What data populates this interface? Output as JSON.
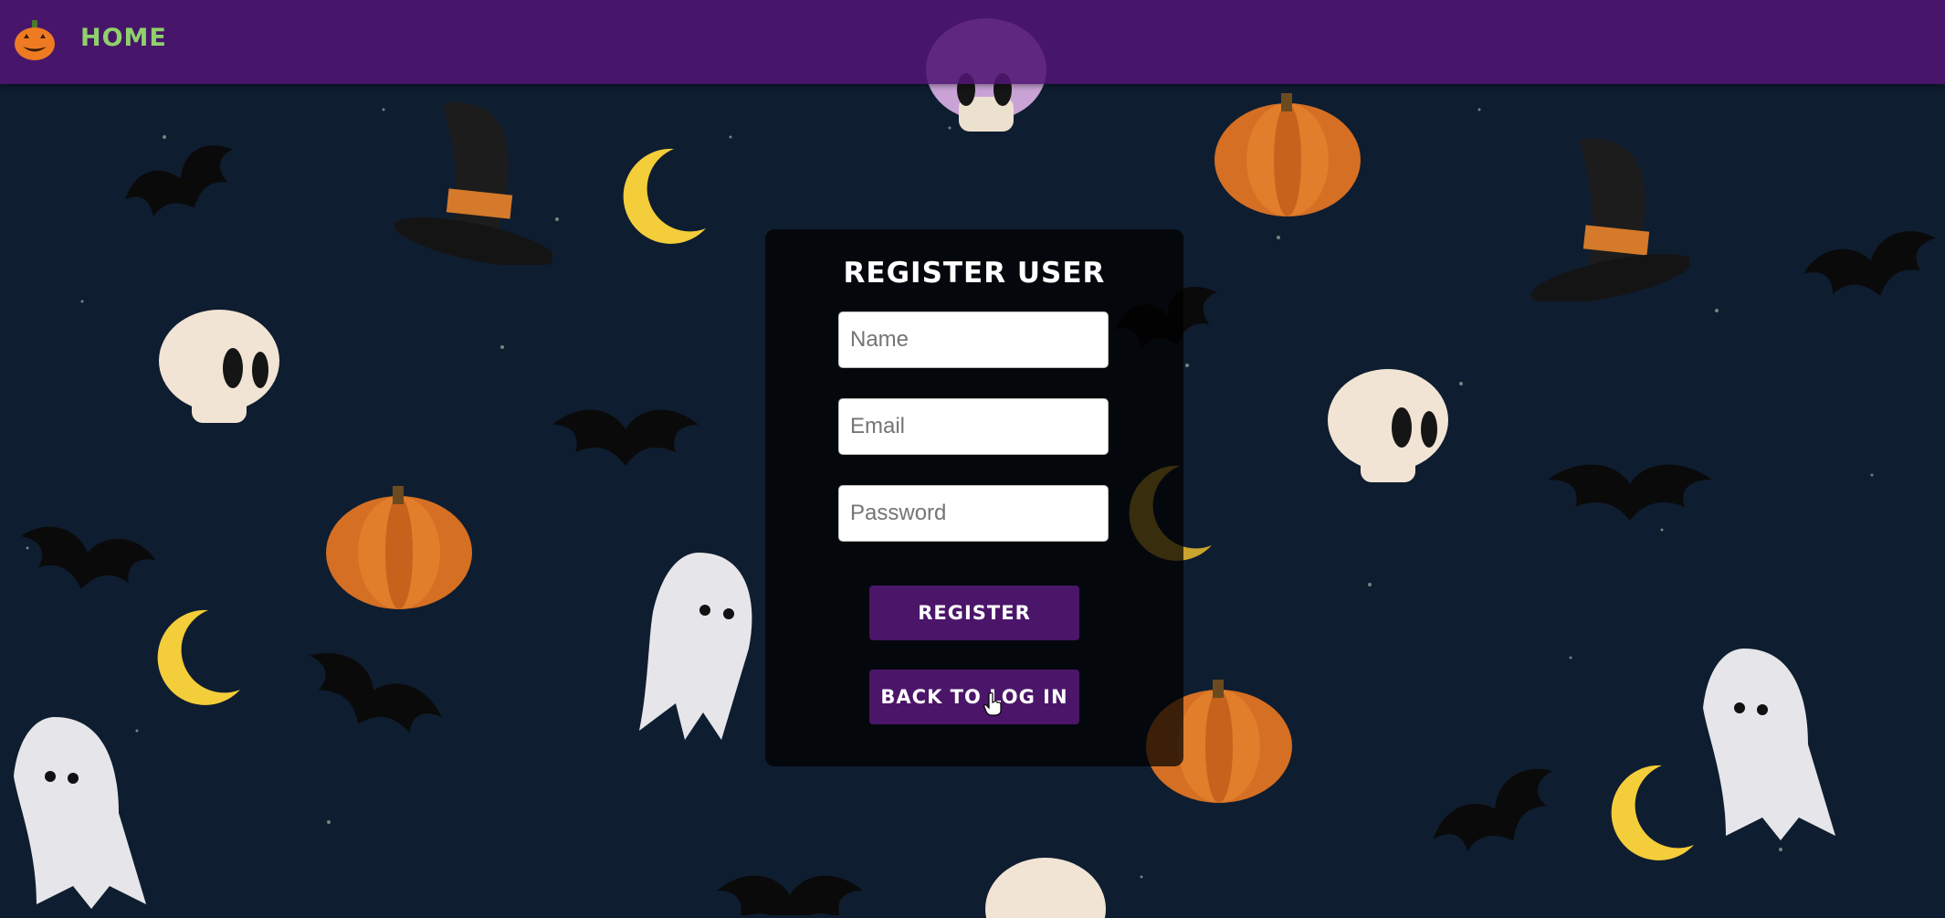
{
  "nav": {
    "home_label": "HOME"
  },
  "form": {
    "title": "REGISTER USER",
    "name_placeholder": "Name",
    "email_placeholder": "Email",
    "password_placeholder": "Password",
    "register_label": "REGISTER",
    "back_label": "BACK TO LOG IN"
  },
  "colors": {
    "background": "#0f1d30",
    "navbar": "#501673",
    "nav_link": "#8fd16a",
    "button": "#4b1569"
  },
  "icons": {
    "logo": "jack-o-lantern-icon",
    "background_pattern": [
      "bat-icon",
      "ghost-icon",
      "skull-icon",
      "pumpkin-icon",
      "moon-icon",
      "witch-hat-icon"
    ]
  }
}
